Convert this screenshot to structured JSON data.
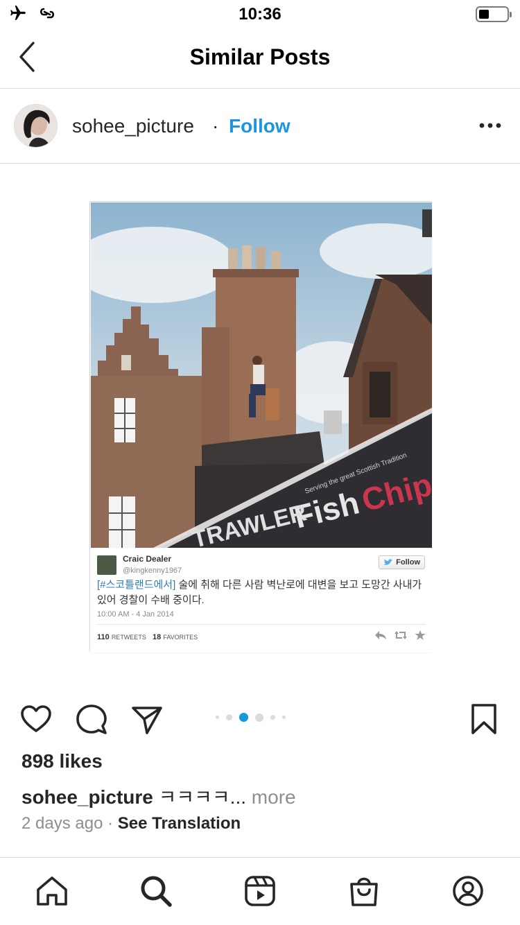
{
  "status_bar": {
    "time": "10:36",
    "icons": [
      "airplane-icon",
      "link-icon",
      "battery-icon"
    ]
  },
  "header": {
    "title": "Similar Posts",
    "back_icon": "chevron-left-icon"
  },
  "post": {
    "username": "sohee_picture",
    "separator": "·",
    "follow_label": "Follow",
    "more_icon": "ellipsis-icon",
    "media": {
      "tweet": {
        "name": "Craic Dealer",
        "handle": "@kingkenny1967",
        "follow_label": "Follow",
        "hashtag": "[#스코틀랜드에서]",
        "text": " 술에 취해 다른 사람 벽난로에 대변을 보고 도망간 사내가 있어 경찰이 수배 중이다.",
        "timestamp": "10:00 AM - 4 Jan 2014",
        "retweets_count": "110",
        "retweets_label": "RETWEETS",
        "favorites_count": "18",
        "favorites_label": "FAVORITES"
      },
      "photo_signage": {
        "tagline": "Serving the great Scottish Tradition",
        "shop_name_left": "Fish",
        "shop_name_right": "Chips",
        "side_text": "TRAWLER"
      }
    },
    "carousel": {
      "count": 6,
      "active_index": 2
    },
    "likes": "898 likes",
    "caption_user": "sohee_picture",
    "caption_text": " ㅋㅋㅋㅋ...",
    "caption_more": " more",
    "time_ago": "2 days ago",
    "meta_sep": " · ",
    "see_translation": "See Translation"
  },
  "tabbar": {
    "items": [
      "home-icon",
      "search-icon",
      "reels-icon",
      "shop-icon",
      "profile-icon"
    ]
  },
  "colors": {
    "accent": "#1b95e0",
    "text": "#262626",
    "muted": "#8e8e8e",
    "divider": "#dbdbdb",
    "carousel_active": "#1b95e0"
  }
}
